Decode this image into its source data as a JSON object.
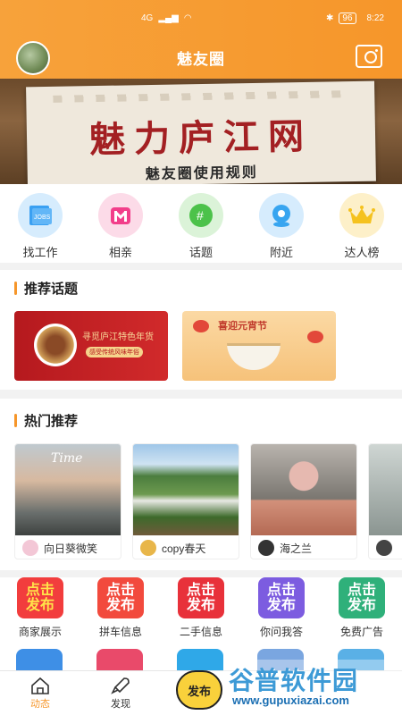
{
  "statusbar": {
    "network": "4G",
    "battery": "96",
    "time": "8:22"
  },
  "header": {
    "title": "魅友圈"
  },
  "banner": {
    "title": "魅力庐江网",
    "subtitle": "魅友圈使用规则"
  },
  "quicknav": [
    {
      "label": "找工作",
      "icon": "jobs-icon",
      "color": "#3aa0f2"
    },
    {
      "label": "相亲",
      "icon": "dating-icon",
      "color": "#f23e8a"
    },
    {
      "label": "话题",
      "icon": "topic-icon",
      "color": "#4cc24a"
    },
    {
      "label": "附近",
      "icon": "nearby-icon",
      "color": "#38a5f0"
    },
    {
      "label": "达人榜",
      "icon": "crown-icon",
      "color": "#f5c21e"
    }
  ],
  "topics_section": {
    "title": "推荐话题",
    "items": [
      {
        "text": "寻觅庐江特色年货",
        "sub": "感受传统风味年俗"
      },
      {
        "text": "喜迎元宵节"
      }
    ]
  },
  "hot_section": {
    "title": "热门推荐",
    "cards": [
      {
        "user": "向日葵微笑",
        "overlay": "Time"
      },
      {
        "user": "copy春天"
      },
      {
        "user": "海之兰"
      },
      {
        "user": ""
      }
    ]
  },
  "publish": {
    "icon_text_1": "点击",
    "icon_text_2": "发布",
    "items": [
      {
        "label": "商家展示",
        "color": "#f23d3d"
      },
      {
        "label": "拼车信息",
        "color": "#f24a3d"
      },
      {
        "label": "二手信息",
        "color": "#e8313a"
      },
      {
        "label": "你问我答",
        "color": "#7c5ce0"
      },
      {
        "label": "免费广告",
        "color": "#2fb07a"
      }
    ]
  },
  "row2_colors": [
    "#3e8fe6",
    "#e94a6a",
    "#2fa8e8",
    "#7aa6e0",
    "#5ab0e6"
  ],
  "bottomnav": {
    "feed": "动态",
    "discover": "发现",
    "publish": "发布"
  },
  "watermark": {
    "brand": "谷普软件园",
    "url": "www.gupuxiazai.com"
  },
  "colors": {
    "accent": "#f6962a",
    "publish_button": "#f9d13b"
  }
}
